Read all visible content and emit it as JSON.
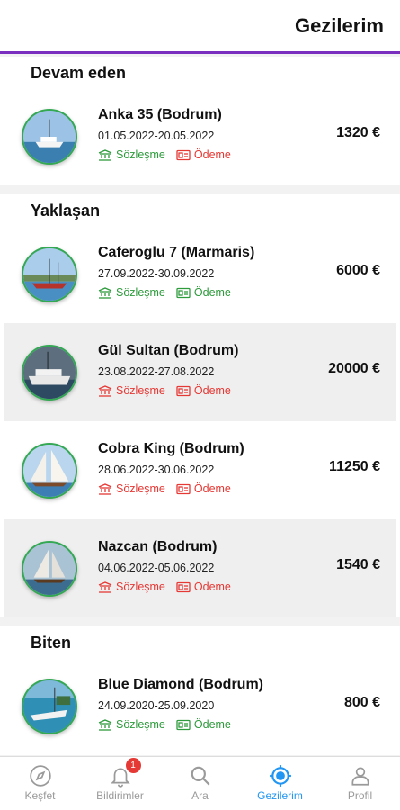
{
  "header": {
    "title": "Gezilerim"
  },
  "sections": [
    {
      "title": "Devam eden",
      "trips": [
        {
          "name": "Anka 35 (Bodrum)",
          "dates": "01.05.2022-20.05.2022",
          "price": "1320 €",
          "contract_label": "Sözleşme",
          "payment_label": "Ödeme",
          "contract_status": "green",
          "payment_status": "red"
        }
      ]
    },
    {
      "title": "Yaklaşan",
      "trips": [
        {
          "name": "Caferoglu 7 (Marmaris)",
          "dates": "27.09.2022-30.09.2022",
          "price": "6000 €",
          "contract_label": "Sözleşme",
          "payment_label": "Ödeme",
          "contract_status": "green",
          "payment_status": "green"
        },
        {
          "name": "Gül Sultan (Bodrum)",
          "dates": "23.08.2022-27.08.2022",
          "price": "20000 €",
          "contract_label": "Sözleşme",
          "payment_label": "Ödeme",
          "contract_status": "red",
          "payment_status": "red"
        },
        {
          "name": "Cobra King (Bodrum)",
          "dates": "28.06.2022-30.06.2022",
          "price": "11250 €",
          "contract_label": "Sözleşme",
          "payment_label": "Ödeme",
          "contract_status": "red",
          "payment_status": "red"
        },
        {
          "name": "Nazcan (Bodrum)",
          "dates": "04.06.2022-05.06.2022",
          "price": "1540 €",
          "contract_label": "Sözleşme",
          "payment_label": "Ödeme",
          "contract_status": "red",
          "payment_status": "red"
        }
      ]
    },
    {
      "title": "Biten",
      "trips": [
        {
          "name": "Blue Diamond (Bodrum)",
          "dates": "24.09.2020-25.09.2020",
          "price": "800 €",
          "contract_label": "Sözleşme",
          "payment_label": "Ödeme",
          "contract_status": "green",
          "payment_status": "green"
        }
      ]
    }
  ],
  "nav": {
    "items": [
      {
        "label": "Keşfet",
        "icon": "compass-icon"
      },
      {
        "label": "Bildirimler",
        "icon": "bell-icon",
        "badge": "1"
      },
      {
        "label": "Ara",
        "icon": "search-icon"
      },
      {
        "label": "Gezilerim",
        "icon": "target-icon",
        "active": true
      },
      {
        "label": "Profil",
        "icon": "user-icon"
      }
    ]
  },
  "colors": {
    "accent": "#7b2fbe",
    "green": "#2e9b3c",
    "red": "#e53935",
    "active": "#2196f3"
  }
}
